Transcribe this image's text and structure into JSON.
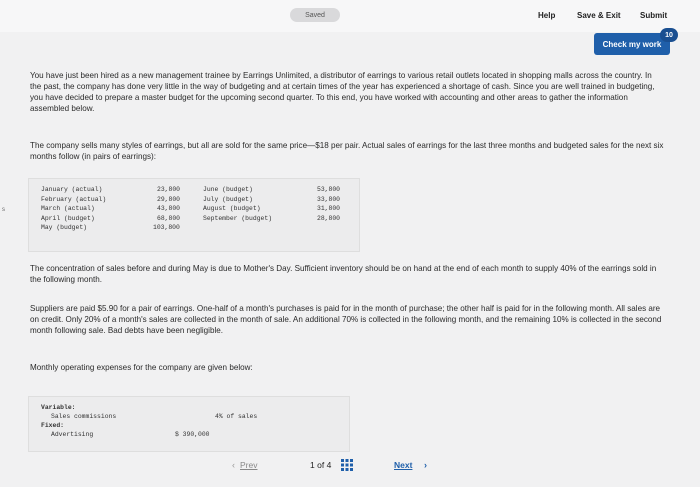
{
  "topbar": {
    "saved": "Saved",
    "help": "Help",
    "save_exit": "Save & Exit",
    "submit": "Submit"
  },
  "check": {
    "label": "Check my work",
    "badge": "10"
  },
  "paragraphs": {
    "p1": "You have just been hired as a new management trainee by Earrings Unlimited, a distributor of earrings to various retail outlets located in shopping malls across the country. In the past, the company has done very little in the way of budgeting and at certain times of the year has experienced a shortage of cash. Since you are well trained in budgeting, you have decided to prepare a master budget for the upcoming second quarter. To this end, you have worked with accounting and other areas to gather the information assembled below.",
    "p2": "The company sells many styles of earrings, but all are sold for the same price—$18 per pair. Actual sales of earrings for the last three months and budgeted sales for the next six months follow (in pairs of earrings):",
    "p3": "The concentration of sales before and during May is due to Mother's Day. Sufficient inventory should be on hand at the end of each month to supply 40% of the earrings sold in the following month.",
    "p4": "Suppliers are paid $5.90 for a pair of earrings. One-half of a month's purchases is paid for in the month of purchase; the other half is paid for in the following month. All sales are on credit. Only 20% of a month's sales are collected in the month of sale. An additional 70% is collected in the following month, and the remaining 10% is collected in the second month following sale. Bad debts have been negligible.",
    "p5": "Monthly operating expenses for the company are given below:"
  },
  "sales_table": {
    "left": [
      {
        "month": "January (actual)",
        "value": "23,800"
      },
      {
        "month": "February (actual)",
        "value": "29,800"
      },
      {
        "month": "March (actual)",
        "value": "43,800"
      },
      {
        "month": "April (budget)",
        "value": "68,800"
      },
      {
        "month": "May (budget)",
        "value": "103,800"
      }
    ],
    "right": [
      {
        "month": "June (budget)",
        "value": "53,800"
      },
      {
        "month": "July (budget)",
        "value": "33,800"
      },
      {
        "month": "August (budget)",
        "value": "31,800"
      },
      {
        "month": "September (budget)",
        "value": "28,800"
      }
    ]
  },
  "expenses": {
    "variable": "Variable:",
    "sales_commissions": "Sales commissions",
    "commission_rate": "4% of sales",
    "fixed": "Fixed:",
    "advertising": "Advertising",
    "advertising_value": "$ 390,000"
  },
  "side_mark": "s",
  "nav": {
    "prev": "Prev",
    "page": "1",
    "of": "of",
    "total": "4",
    "next": "Next"
  }
}
